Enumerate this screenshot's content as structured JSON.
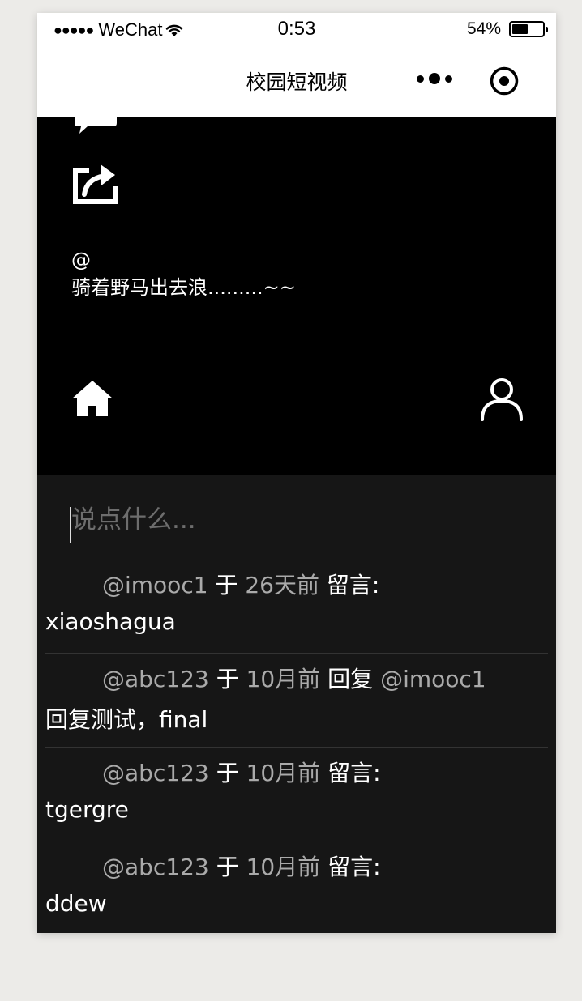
{
  "status_bar": {
    "signal_dots": "●●●●●",
    "carrier": "WeChat",
    "time": "0:53",
    "battery_text": "54%",
    "battery_level": 0.54
  },
  "nav": {
    "title": "校园短视频"
  },
  "video": {
    "caption_at": "@",
    "caption_text": "骑着野马出去浪.........~~"
  },
  "comment_input": {
    "placeholder": "说点什么..."
  },
  "comments": [
    {
      "user": "@imooc1",
      "yu": "于",
      "time": "26天前",
      "action": "留言:",
      "reply_to": "",
      "text": "xiaoshagua"
    },
    {
      "user": "@abc123",
      "yu": "于",
      "time": "10月前",
      "action": "回复",
      "reply_to": "@imooc1",
      "text": "回复测试，final"
    },
    {
      "user": "@abc123",
      "yu": "于",
      "time": "10月前",
      "action": "留言:",
      "reply_to": "",
      "text": "tgergre"
    },
    {
      "user": "@abc123",
      "yu": "于",
      "time": "10月前",
      "action": "留言:",
      "reply_to": "",
      "text": "ddew"
    }
  ],
  "colors": {
    "page_bg": "#ecebe8",
    "video_bg": "#000000",
    "comment_bg": "#161616",
    "meta_gray": "#aaaaaa"
  }
}
